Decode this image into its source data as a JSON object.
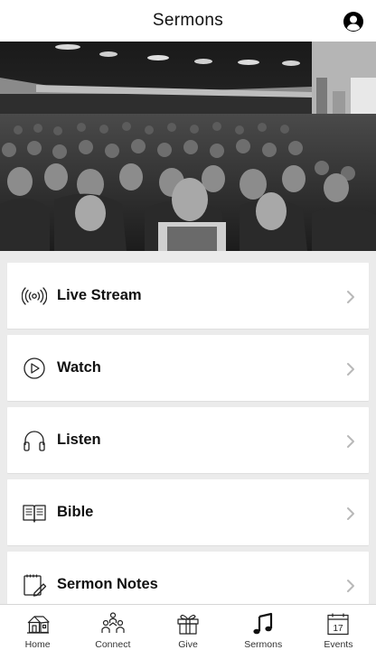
{
  "header": {
    "title": "Sermons",
    "profile_icon": "user-circle-icon"
  },
  "hero": {
    "description_icon": "congregation-photo"
  },
  "menu": {
    "items": [
      {
        "label": "Live Stream",
        "icon": "broadcast-icon"
      },
      {
        "label": "Watch",
        "icon": "play-circle-icon"
      },
      {
        "label": "Listen",
        "icon": "headphones-icon"
      },
      {
        "label": "Bible",
        "icon": "open-book-icon"
      },
      {
        "label": "Sermon Notes",
        "icon": "notepad-pencil-icon"
      }
    ]
  },
  "tabbar": {
    "items": [
      {
        "label": "Home",
        "icon": "house-icon",
        "active": false
      },
      {
        "label": "Connect",
        "icon": "people-icon",
        "active": false
      },
      {
        "label": "Give",
        "icon": "gift-icon",
        "active": false
      },
      {
        "label": "Sermons",
        "icon": "music-note-icon",
        "active": true
      },
      {
        "label": "Events",
        "icon": "calendar-icon",
        "active": false,
        "badge_text": "17"
      }
    ]
  },
  "colors": {
    "background": "#ebebeb",
    "card": "#ffffff",
    "text": "#111111",
    "chevron": "#b8b8b8"
  }
}
